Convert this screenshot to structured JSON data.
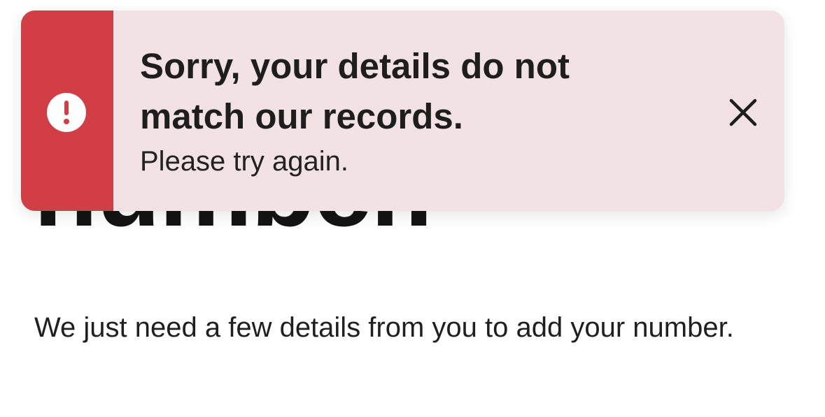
{
  "alert": {
    "title": "Sorry, your details do not match our records.",
    "message": "Please try again.",
    "icon": "exclamation-circle-icon",
    "close_icon": "close-icon",
    "accent_color": "#d13e45",
    "background_color": "#f2e2e3"
  },
  "page": {
    "heading": "number.",
    "body": "We just need a few details from you to add your number."
  }
}
